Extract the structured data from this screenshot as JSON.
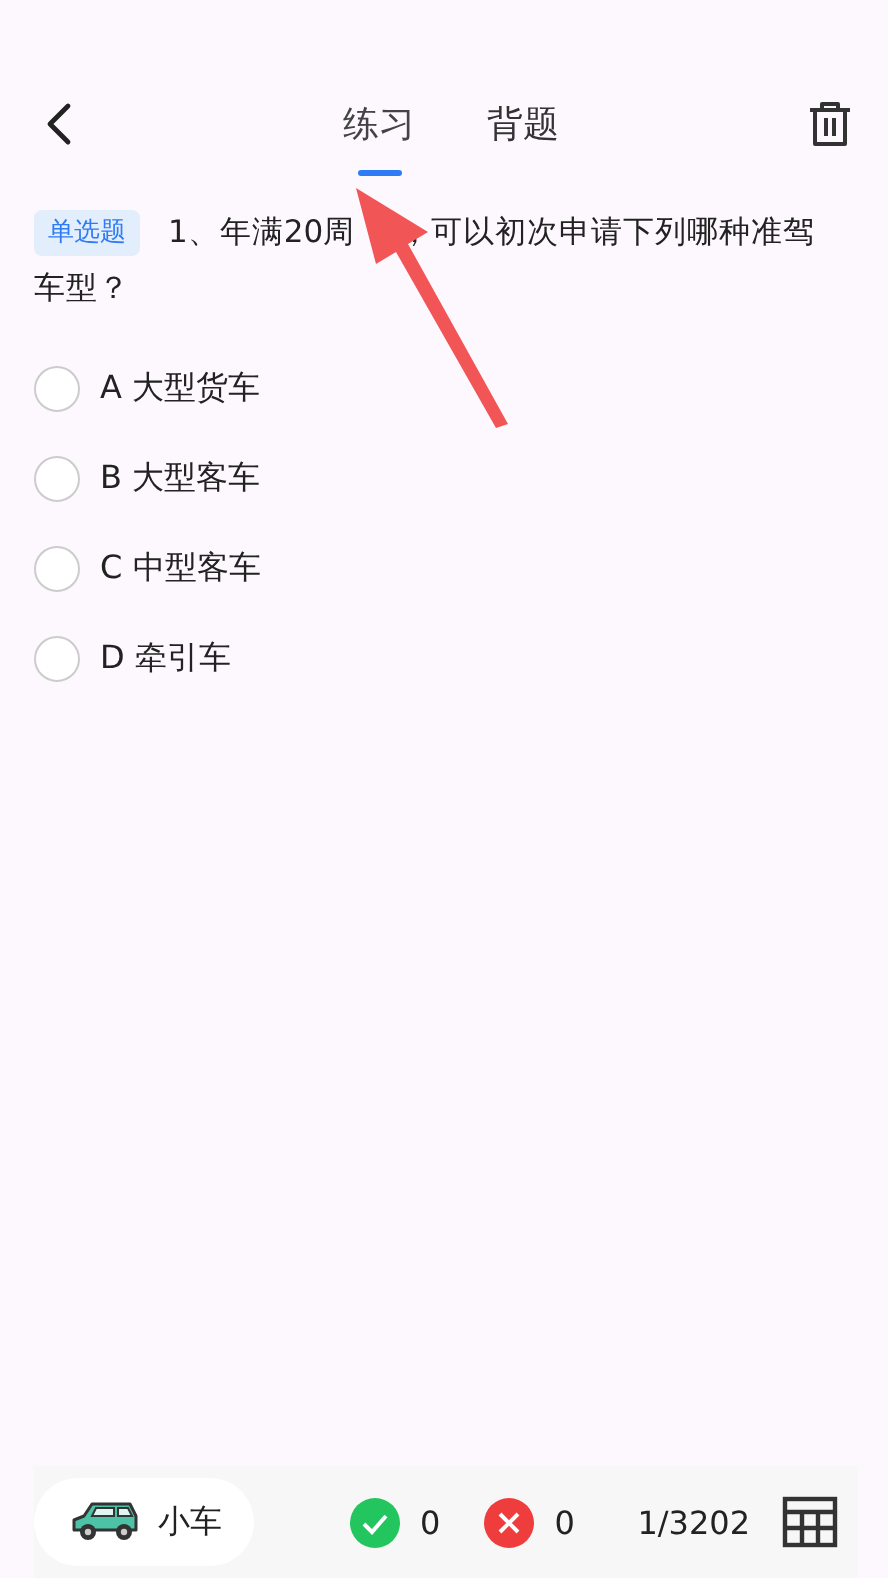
{
  "header": {
    "tabs": [
      {
        "label": "练习",
        "selected": true
      },
      {
        "label": "背题",
        "selected": false
      }
    ]
  },
  "question": {
    "type_tag": "单选题",
    "text_parts": [
      "1、年满20周",
      "，可以初次申请下列哪种准驾",
      "车型？"
    ]
  },
  "options": [
    {
      "label": "A 大型货车",
      "selected": false
    },
    {
      "label": "B 大型客车",
      "selected": false
    },
    {
      "label": "C 中型客车",
      "selected": false
    },
    {
      "label": "D 牵引车",
      "selected": false
    }
  ],
  "footer": {
    "vehicle": "小车",
    "correct_count": "0",
    "wrong_count": "0",
    "progress": "1/3202"
  }
}
